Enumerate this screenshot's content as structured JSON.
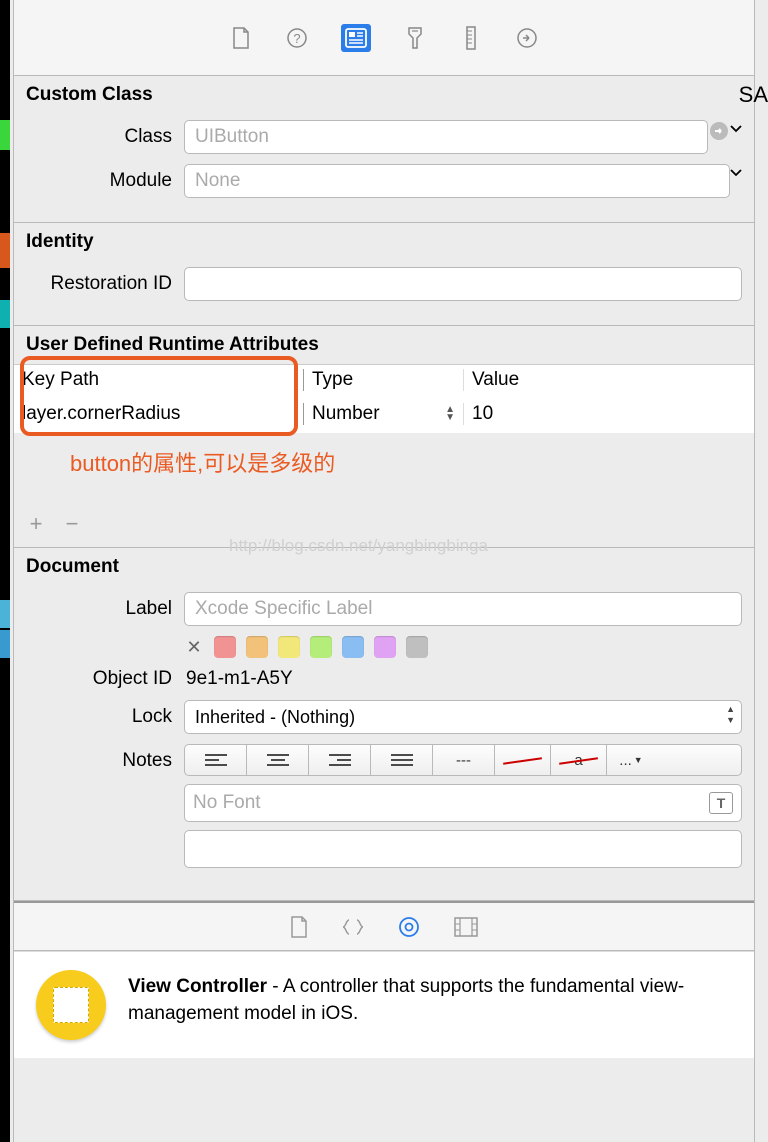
{
  "custom_class": {
    "title": "Custom Class",
    "class_label": "Class",
    "class_placeholder": "UIButton",
    "module_label": "Module",
    "module_placeholder": "None"
  },
  "identity": {
    "title": "Identity",
    "restoration_label": "Restoration ID"
  },
  "runtime_attrs": {
    "title": "User Defined Runtime Attributes",
    "col_keypath": "Key Path",
    "col_type": "Type",
    "col_value": "Value",
    "row": {
      "keypath": "layer.cornerRadius",
      "type": "Number",
      "value": "10"
    },
    "annotation": "button的属性,可以是多级的",
    "watermark": "http://blog.csdn.net/yangbingbinga"
  },
  "document": {
    "title": "Document",
    "label_label": "Label",
    "label_placeholder": "Xcode Specific Label",
    "objectid_label": "Object ID",
    "objectid_value": "9e1-m1-A5Y",
    "lock_label": "Lock",
    "lock_value": "Inherited - (Nothing)",
    "notes_label": "Notes",
    "font_placeholder": "No Font",
    "strike_a": "a",
    "dash": "---",
    "dots": "..."
  },
  "info": {
    "title": "View Controller",
    "desc": " - A controller that supports the fundamental view-management model in iOS."
  },
  "colors": {
    "swatches": [
      "#f29393",
      "#f2c17a",
      "#f2e87a",
      "#b4ed7a",
      "#8abdf2",
      "#e0a2f2",
      "#bfbfbf"
    ]
  },
  "right_crop_text": "SA"
}
